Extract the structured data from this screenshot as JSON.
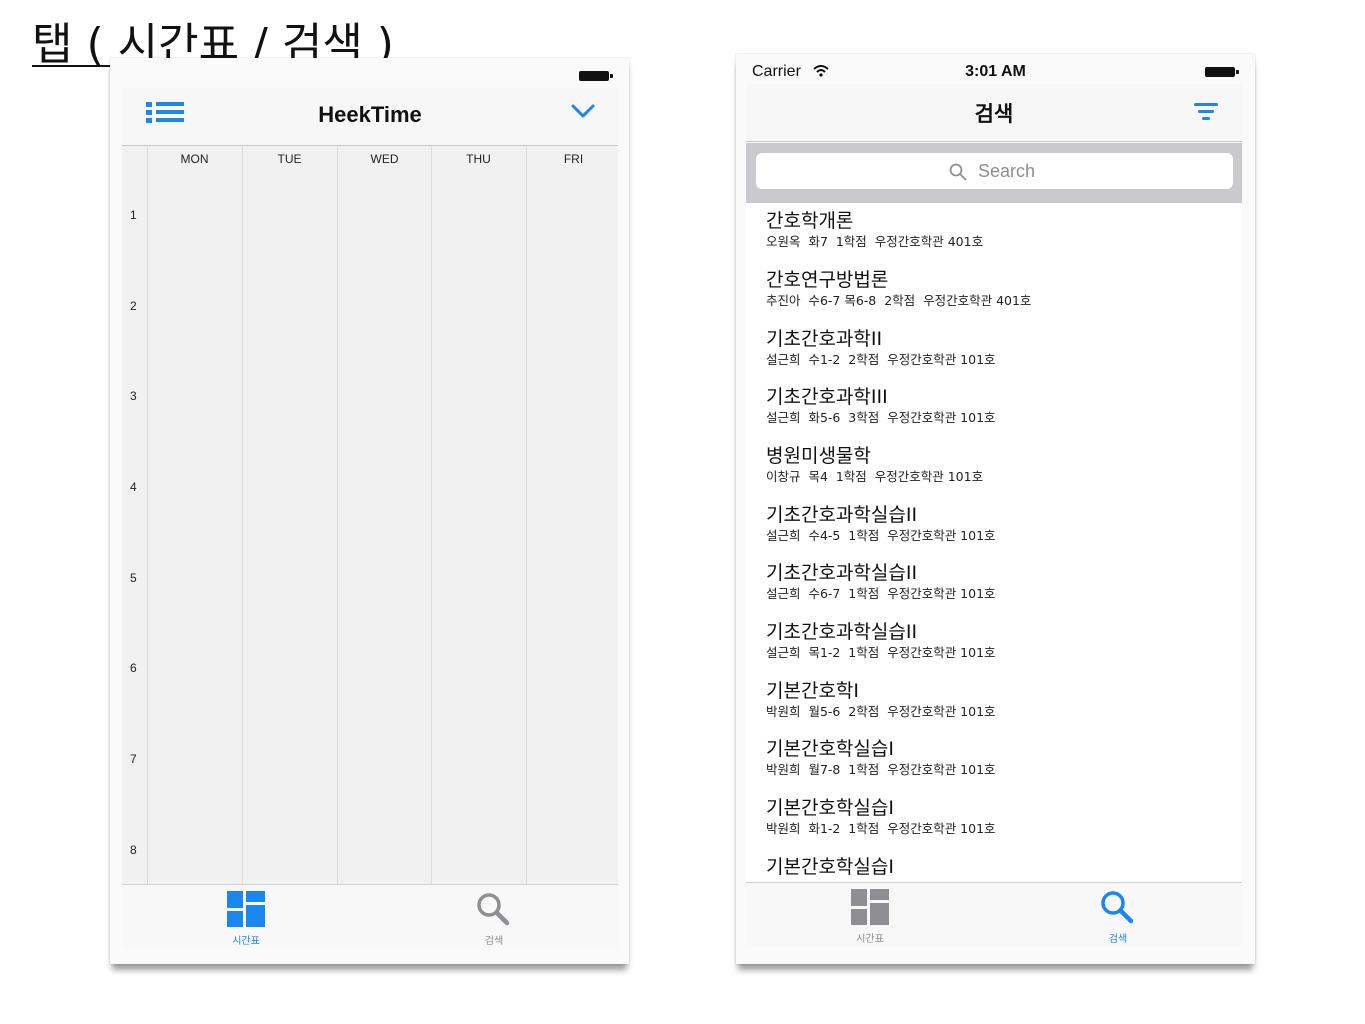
{
  "page_title": "탭 ( 시간표 / 검색 )",
  "timetable_screen": {
    "nav_title": "HeekTime",
    "days": [
      "MON",
      "TUE",
      "WED",
      "THU",
      "FRI"
    ],
    "hours": [
      "1",
      "2",
      "3",
      "4",
      "5",
      "6",
      "7",
      "8"
    ],
    "tabs": [
      {
        "label": "시간표",
        "icon": "grid-icon",
        "selected": true
      },
      {
        "label": "검색",
        "icon": "search-icon",
        "selected": false
      }
    ]
  },
  "search_screen": {
    "status": {
      "carrier": "Carrier",
      "time": "3:01 AM"
    },
    "nav_title": "검색",
    "search_placeholder": "Search",
    "results": [
      {
        "title": "간호학개론",
        "detail": "오원옥  화7  1학점  우정간호학관 401호"
      },
      {
        "title": "간호연구방법론",
        "detail": "추진아  수6-7 목6-8  2학점  우정간호학관 401호"
      },
      {
        "title": "기초간호과학II",
        "detail": "설근희  수1-2  2학점  우정간호학관 101호"
      },
      {
        "title": "기초간호과학III",
        "detail": "설근희  화5-6  3학점  우정간호학관 101호"
      },
      {
        "title": "병원미생물학",
        "detail": "이창규  목4  1학점  우정간호학관 101호"
      },
      {
        "title": "기초간호과학실습II",
        "detail": "설근희  수4-5  1학점  우정간호학관 101호"
      },
      {
        "title": "기초간호과학실습II",
        "detail": "설근희  수6-7  1학점  우정간호학관 101호"
      },
      {
        "title": "기초간호과학실습II",
        "detail": "설근희  목1-2  1학점  우정간호학관 101호"
      },
      {
        "title": "기본간호학I",
        "detail": "박원희  월5-6  2학점  우정간호학관 101호"
      },
      {
        "title": "기본간호학실습I",
        "detail": "박원희  월7-8  1학점  우정간호학관 101호"
      },
      {
        "title": "기본간호학실습I",
        "detail": "박원희  화1-2  1학점  우정간호학관 101호"
      },
      {
        "title": "기본간호학실습I",
        "detail": ""
      }
    ],
    "tabs": [
      {
        "label": "시간표",
        "icon": "grid-icon",
        "selected": false
      },
      {
        "label": "검색",
        "icon": "search-icon",
        "selected": true
      }
    ]
  },
  "colors": {
    "accent": "#1a86ee",
    "inactive": "#8e8e93",
    "grid_bg": "#f1f1f1"
  }
}
